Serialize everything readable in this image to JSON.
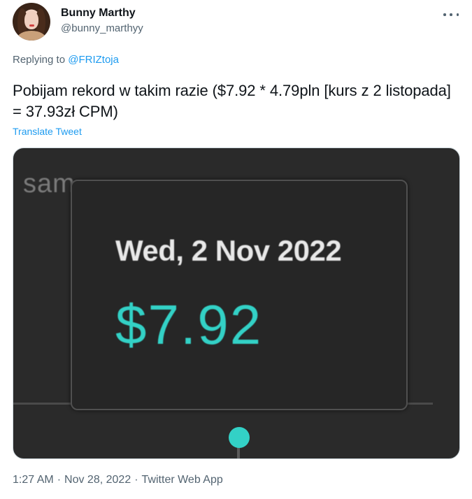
{
  "user": {
    "name": "Bunny Marthy",
    "handle": "@bunny_marthyy"
  },
  "reply": {
    "prefix": "Replying to ",
    "mention": "@FRIZtoja"
  },
  "tweet": {
    "text": "Pobijam rekord w takim razie ($7.92 * 4.79pln [kurs z 2 listopada] = 37.93zł CPM)",
    "translate_label": "Translate Tweet"
  },
  "media": {
    "bg_text_left": "sam",
    "bg_text_right": "",
    "tooltip_date": "Wed, 2 Nov 2022",
    "tooltip_value": "$7.92",
    "accent_color": "#33d1c6"
  },
  "meta": {
    "time": "1:27 AM",
    "date": "Nov 28, 2022",
    "source": "Twitter Web App",
    "separator": "·"
  }
}
